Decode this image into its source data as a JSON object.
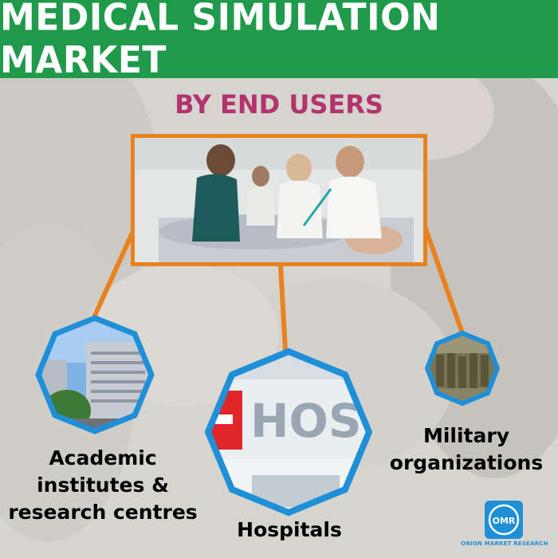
{
  "header": {
    "title": "MEDICAL SIMULATION MARKET"
  },
  "subtitle": "BY END USERS",
  "segments": [
    {
      "label": "Academic institutes & research centres",
      "lines": [
        "Academic",
        "institutes &",
        "research centres"
      ]
    },
    {
      "label": "Hospitals",
      "sign_text": "HOSP"
    },
    {
      "label": "Military organizations",
      "lines": [
        "Military",
        "organizations"
      ]
    }
  ],
  "logo": {
    "monogram": "OMR",
    "name": "ORION MARKET RESEARCH"
  },
  "colors": {
    "header_green": "#1f9a4a",
    "subtitle_magenta": "#b3336e",
    "connector_orange": "#e8821e",
    "hex_blue": "#1f8fd8"
  }
}
